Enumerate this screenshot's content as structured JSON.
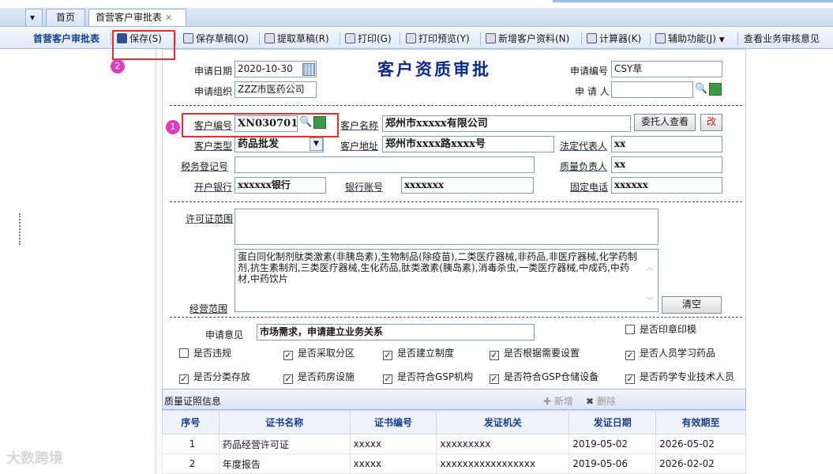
{
  "tabs": {
    "home": "首页",
    "current": "首营客户审批表"
  },
  "toolbar": {
    "section": "首营客户审批表",
    "save": "保存(S)",
    "save_draft": "保存草稿(Q)",
    "fetch_draft": "提取草稿(R)",
    "print": "打印(G)",
    "print_preview": "打印预览(Y)",
    "add_customer": "新增客户资料(N)",
    "calculator": "计算器(K)",
    "assist": "辅助功能(J)",
    "review": "查看业务审核意见"
  },
  "form": {
    "title": "客户资质审批",
    "apply_date_label": "申请日期",
    "apply_date": "2020-10-30",
    "apply_org_label": "申请组织",
    "apply_org": "ZZZ市医药公司",
    "apply_no_label": "申请编号",
    "apply_no": "CSY草",
    "applicant_label": "申 请 人",
    "applicant": "",
    "cust_no_label": "客户编号",
    "cust_no": "XN0307012",
    "cust_name_label": "客户名称",
    "cust_name": "郑州市xxxxx有限公司",
    "agent_btn": "委托人查看",
    "edit_btn": "改",
    "cust_type_label": "客户类型",
    "cust_type": "药品批发",
    "cust_addr_label": "客户地址",
    "cust_addr": "郑州市xxxx路xxxx号",
    "legal_label": "法定代表人",
    "legal": "xx",
    "tax_label": "税务登记号",
    "tax": "",
    "quality_label": "质量负责人",
    "quality": "xx",
    "bank_label": "开户银行",
    "bank": "xxxxxx银行",
    "account_label": "银行账号",
    "account": "xxxxxxx",
    "phone_label": "固定电话",
    "phone": "xxxxxx",
    "license_label": "许可证范围",
    "license": "",
    "scope_text": "蛋白同化制剂肽类激素(非胰岛素),生物制品(除疫苗),二类医疗器械,非药品,非医疗器械,化学药制剂,抗生素制剂,三类医疗器械,生化药品,肽类激素(胰岛素),消毒杀虫,一类医疗器械,中成药,中药材,中药饮片",
    "scope_label": "经营范围",
    "clear_btn": "清空",
    "opinion_label": "申请意见",
    "opinion": "市场需求，申请建立业务关系",
    "seal_label": "是否印章印模"
  },
  "checks": [
    {
      "label": "是否违规",
      "checked": false
    },
    {
      "label": "是否采取分区",
      "checked": true
    },
    {
      "label": "是否建立制度",
      "checked": true
    },
    {
      "label": "是否根据需要设置",
      "checked": true
    },
    {
      "label": "是否人员学习药品",
      "checked": true
    },
    {
      "label": "是否分类存放",
      "checked": true
    },
    {
      "label": "是否药房设施",
      "checked": true
    },
    {
      "label": "是否符合GSP机构",
      "checked": true
    },
    {
      "label": "是否符合GSP仓储设备",
      "checked": true
    },
    {
      "label": "是否药学专业技术人员",
      "checked": true
    }
  ],
  "grid": {
    "title": "质量证照信息",
    "add": "新增",
    "delete": "删除",
    "headers": [
      "序号",
      "证书名称",
      "证书编号",
      "发证机关",
      "发证日期",
      "有效期至"
    ],
    "rows": [
      [
        "1",
        "药品经营许可证",
        "xxxxx",
        "xxxxxxxxx",
        "2019-05-02",
        "2026-05-02"
      ],
      [
        "2",
        "年度报告",
        "xxxxx",
        "xxxxxxxxxxxxxxxxx",
        "2019-05-06",
        "2026-02-02"
      ]
    ]
  },
  "annotations": {
    "one": "1",
    "two": "2"
  },
  "watermark": "大数跨境"
}
